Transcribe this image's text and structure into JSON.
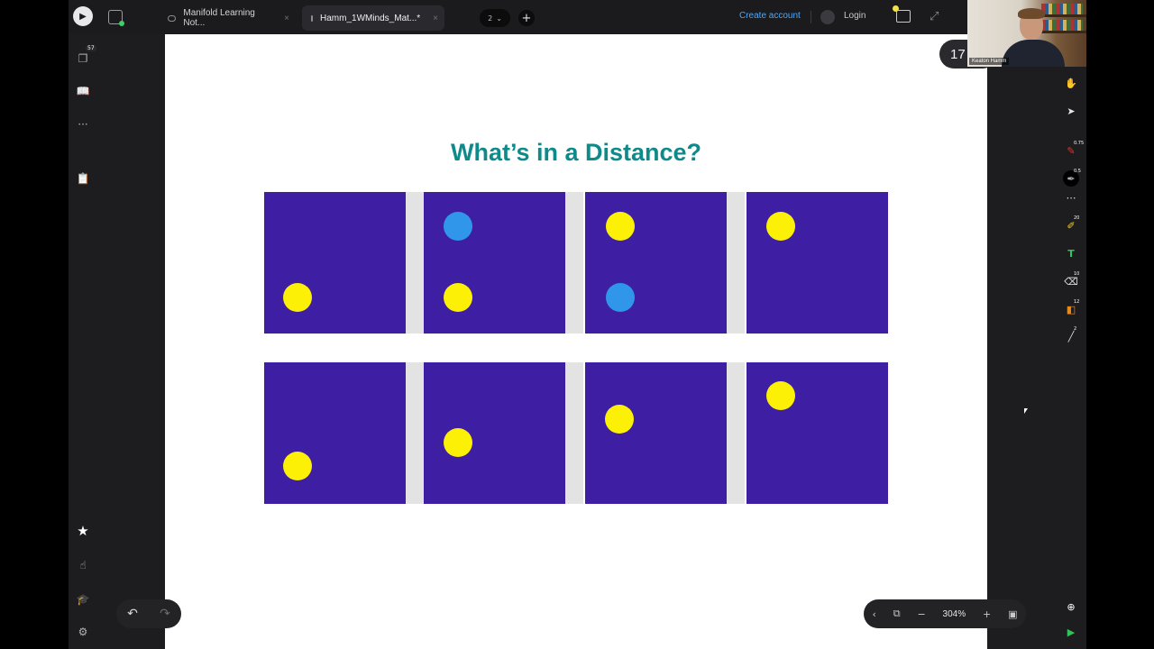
{
  "tabs": [
    {
      "label": "Manifold Learning Not...",
      "close": "×"
    },
    {
      "label": "Hamm_1WMinds_Mat...*",
      "close": "×"
    }
  ],
  "topbar": {
    "page_count": "2",
    "new_tab": "+",
    "create_account": "Create account",
    "login": "Login"
  },
  "leftbar": {
    "pages_badge": "57",
    "more": "···"
  },
  "slide": {
    "title": "What’s in a Distance?"
  },
  "rightbar": {
    "badges": [
      "0.75",
      "0.5",
      "20",
      "10",
      "12",
      "2"
    ]
  },
  "undo": {
    "undo_glyph": "↶",
    "redo_glyph": "↷"
  },
  "zoom": {
    "value": "304%",
    "minus": "−",
    "plus": "+",
    "back": "‹"
  },
  "page_indicator": "17",
  "webcam": {
    "name": "Keaton Hamm"
  },
  "colors": {
    "title": "#0e8a8a",
    "panel": "#3e1fa3",
    "dot_yellow": "#fbf006",
    "dot_blue": "#2f96ea",
    "link": "#49a8ff"
  }
}
